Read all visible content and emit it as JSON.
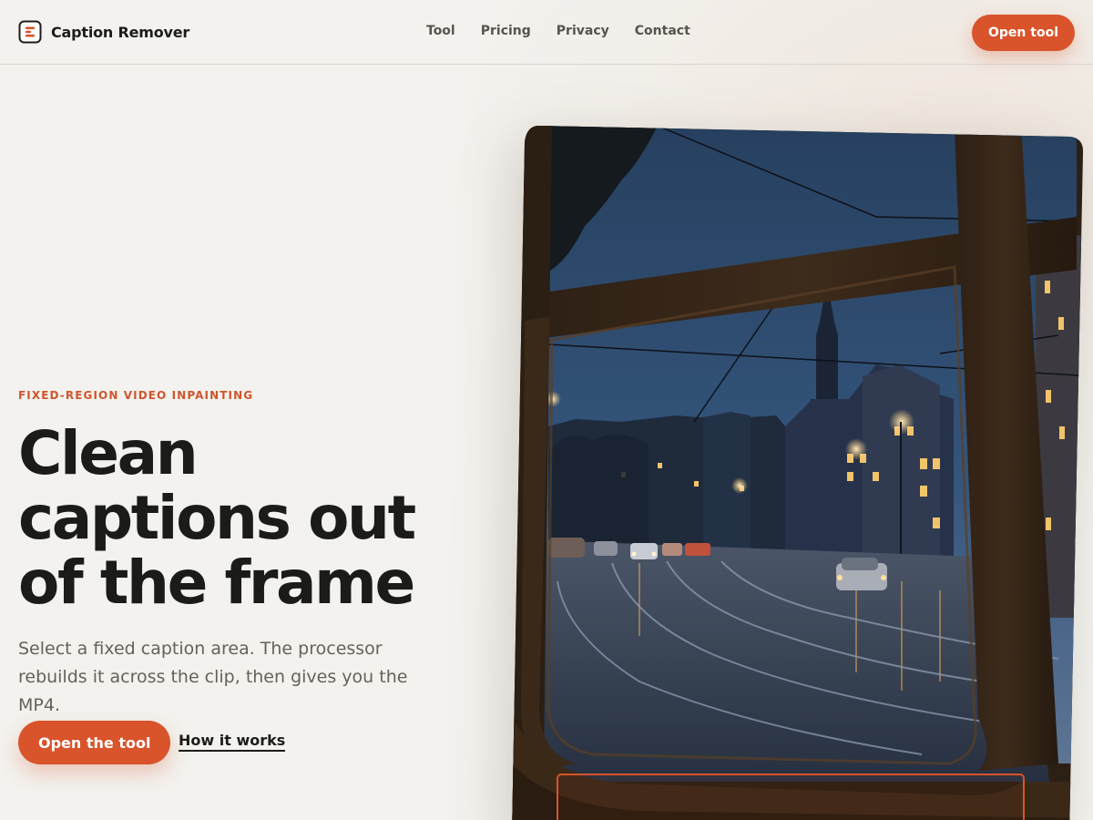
{
  "header": {
    "brand_name": "Caption Remover",
    "nav": [
      {
        "label": "Tool"
      },
      {
        "label": "Pricing"
      },
      {
        "label": "Privacy"
      },
      {
        "label": "Contact"
      }
    ],
    "cta_label": "Open tool"
  },
  "hero": {
    "eyebrow": "FIXED-REGION VIDEO INPAINTING",
    "headline": "Clean captions out of the frame",
    "lede": "Select a fixed caption area. The processor rebuilds it across the clip, then gives you the MP4.",
    "primary_cta": "Open the tool",
    "secondary_link": "How it works"
  },
  "visual": {
    "subject": "rainy-city-street-through-tram-window",
    "caption_region": "selected-caption-area-outline"
  },
  "colors": {
    "background": "#f3f2ee",
    "accent": "#d9532b",
    "text": "#1c1c1a",
    "muted_text": "#63625c",
    "nav_text": "#55544f"
  }
}
